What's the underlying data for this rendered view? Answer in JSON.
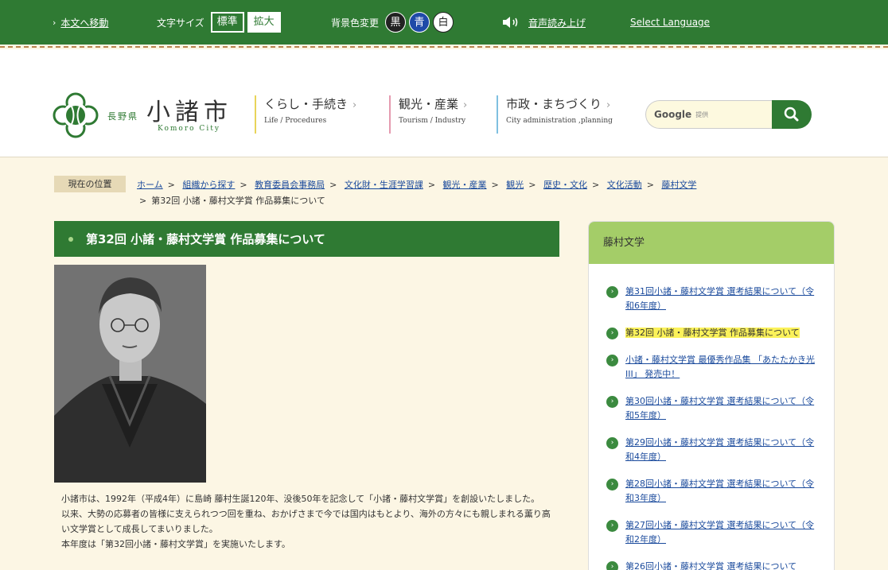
{
  "topbar": {
    "skip_link": "本文へ移動",
    "font_size_label": "文字サイズ",
    "font_std": "標準",
    "font_large": "拡大",
    "bg_label": "背景色変更",
    "bg_black": "黒",
    "bg_blue": "青",
    "bg_white": "白",
    "voice": "音声読み上げ",
    "language": "Select Language"
  },
  "logo": {
    "prefecture": "長野県",
    "city": "小諸市",
    "city_en": "Komoro City"
  },
  "gnav": [
    {
      "ja": "くらし・手続き",
      "en": "Life / Procedures"
    },
    {
      "ja": "観光・産業",
      "en": "Tourism / Industry"
    },
    {
      "ja": "市政・まちづくり",
      "en": "City administration ,planning"
    }
  ],
  "search": {
    "brand": "Google",
    "provided": "提供"
  },
  "breadcrumb": {
    "label": "現在の位置",
    "items": [
      "ホーム",
      "組織から探す",
      "教育委員会事務局",
      "文化財・生涯学習課",
      "観光・産業",
      "観光",
      "歴史・文化",
      "文化活動",
      "藤村文学"
    ],
    "current": "第32回 小諸・藤村文学賞 作品募集について"
  },
  "main": {
    "title": "第32回 小諸・藤村文学賞 作品募集について",
    "paragraphs": [
      "小諸市は、1992年（平成4年）に島崎 藤村生誕120年、没後50年を記念して「小諸・藤村文学賞」を創設いたしました。",
      "以来、大勢の応募者の皆様に支えられつつ回を重ね、おかげさまで今では国内はもとより、海外の方々にも親しまれる薫り高い文学賞として成長してまいりました。",
      "本年度は「第32回小諸・藤村文学賞」を実施いたします。"
    ]
  },
  "sidebar": {
    "title": "藤村文学",
    "items": [
      "第31回小諸・藤村文学賞 選考結果について（令和6年度）",
      "第32回 小諸・藤村文学賞 作品募集について",
      "小諸・藤村文学賞 最優秀作品集 「あたたかき光III」 発売中！",
      "第30回小諸・藤村文学賞 選考結果について（令和5年度）",
      "第29回小諸・藤村文学賞 選考結果について（令和4年度）",
      "第28回小諸・藤村文学賞 選考結果について（令和3年度）",
      "第27回小諸・藤村文学賞 選考結果について（令和2年度）",
      "第26回小諸・藤村文学賞 選考結果について"
    ]
  }
}
